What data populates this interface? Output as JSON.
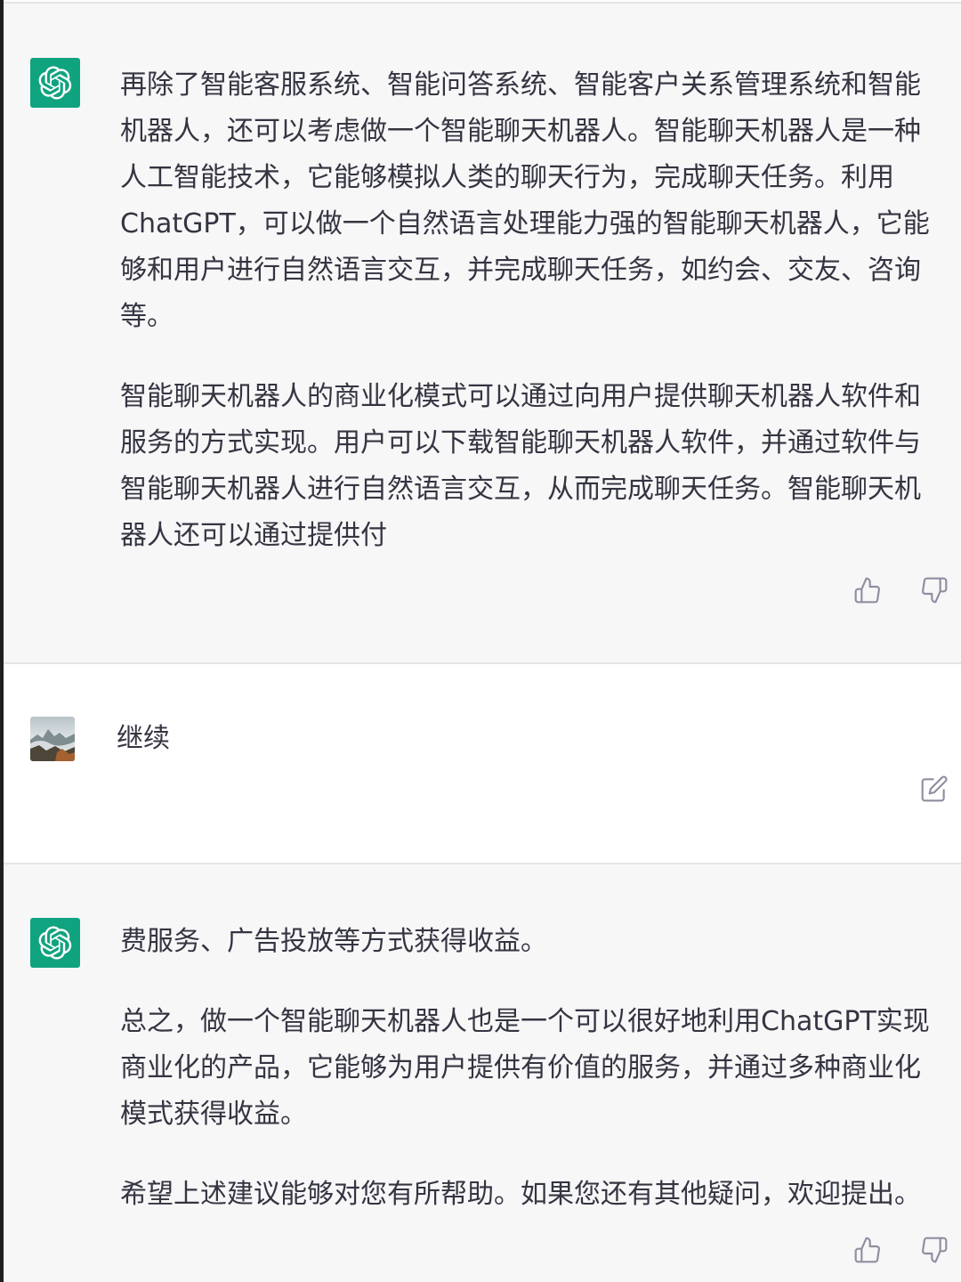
{
  "conversation": {
    "msg1": {
      "role": "assistant",
      "paragraphs": [
        "再除了智能客服系统、智能问答系统、智能客户关系管理系统和智能机器人，还可以考虑做一个智能聊天机器人。智能聊天机器人是一种人工智能技术，它能够模拟人类的聊天行为，完成聊天任务。利用ChatGPT，可以做一个自然语言处理能力强的智能聊天机器人，它能够和用户进行自然语言交互，并完成聊天任务，如约会、交友、咨询等。",
        "智能聊天机器人的商业化模式可以通过向用户提供聊天机器人软件和服务的方式实现。用户可以下载智能聊天机器人软件，并通过软件与智能聊天机器人进行自然语言交互，从而完成聊天任务。智能聊天机器人还可以通过提供付"
      ]
    },
    "msg2": {
      "role": "user",
      "text": "继续"
    },
    "msg3": {
      "role": "assistant",
      "paragraphs": [
        "费服务、广告投放等方式获得收益。",
        "总之，做一个智能聊天机器人也是一个可以很好地利用ChatGPT实现商业化的产品，它能够为用户提供有价值的服务，并通过多种商业化模式获得收益。",
        "希望上述建议能够对您有所帮助。如果您还有其他疑问，欢迎提出。"
      ]
    }
  },
  "icons": {
    "assistant_avatar": "openai-logo-icon",
    "user_avatar": "mountain-landscape-photo",
    "like": "thumbs-up-icon",
    "dislike": "thumbs-down-icon",
    "edit": "edit-icon"
  },
  "colors": {
    "assistant_bg": "#f7f7f8",
    "user_bg": "#ffffff",
    "avatar_green": "#10a37f",
    "text": "#343541",
    "icon": "#8e8ea0"
  }
}
